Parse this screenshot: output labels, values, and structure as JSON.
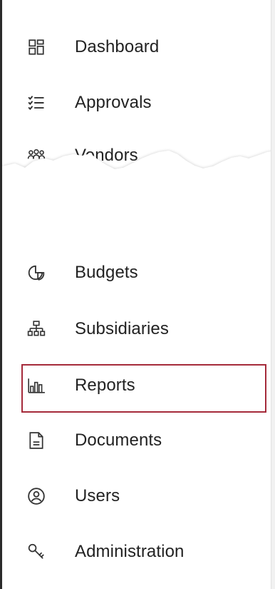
{
  "sidebar": {
    "items": [
      {
        "id": "dashboard",
        "label": "Dashboard",
        "icon": "dashboard-grid-icon"
      },
      {
        "id": "approvals",
        "label": "Approvals",
        "icon": "checklist-icon"
      },
      {
        "id": "vendors",
        "label": "Vendors",
        "icon": "people-group-icon"
      },
      {
        "id": "budgets",
        "label": "Budgets",
        "icon": "pie-chart-icon"
      },
      {
        "id": "subsidiaries",
        "label": "Subsidiaries",
        "icon": "org-chart-icon"
      },
      {
        "id": "reports",
        "label": "Reports",
        "icon": "bar-chart-icon",
        "selected": true
      },
      {
        "id": "documents",
        "label": "Documents",
        "icon": "document-icon"
      },
      {
        "id": "users",
        "label": "Users",
        "icon": "user-circle-icon"
      },
      {
        "id": "administration",
        "label": "Administration",
        "icon": "key-icon"
      }
    ]
  },
  "colors": {
    "highlight_border": "#a52a3a",
    "text": "#222222",
    "icon_stroke": "#333333"
  }
}
